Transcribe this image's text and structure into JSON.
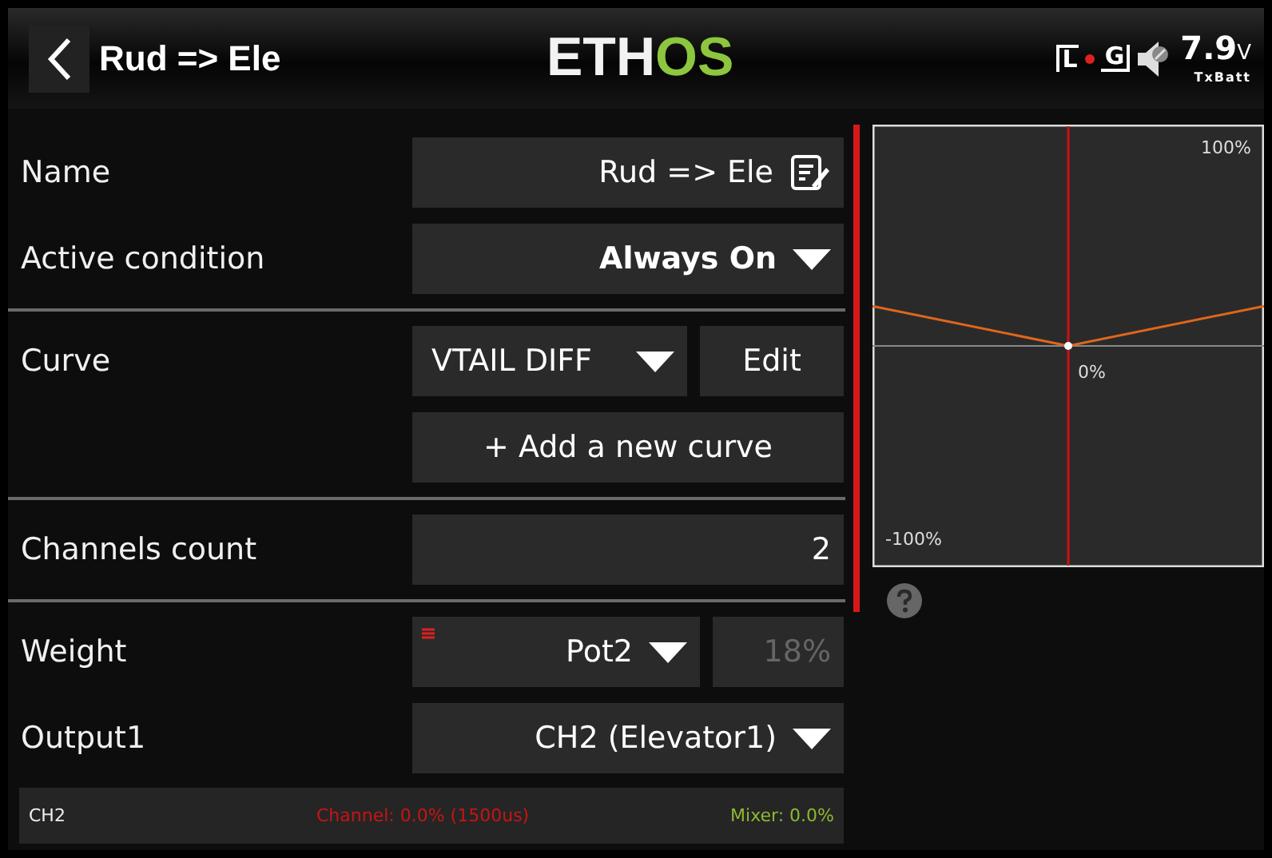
{
  "header": {
    "title": "Rud => Ele",
    "logo": {
      "part1": "ETH",
      "part2": "OS"
    },
    "status": {
      "left_marker": "L",
      "right_marker": "G",
      "voltage": "7.9",
      "unit": "V",
      "battery_label": "TxBatt"
    }
  },
  "rows": [
    {
      "kind": "text",
      "label": "Name",
      "value": "Rud => Ele",
      "bold": false,
      "divider_after": false
    },
    {
      "kind": "dropdown",
      "label": "Active condition",
      "value": "Always On",
      "bold": true,
      "divider_after": true
    },
    {
      "kind": "curve",
      "label": "Curve",
      "value": "VTAIL DIFF",
      "button": "Edit",
      "add_button": "+ Add a new curve",
      "divider_after": true
    },
    {
      "kind": "number",
      "label": "Channels count",
      "value": "2",
      "divider_after": true
    },
    {
      "kind": "weight",
      "label": "Weight",
      "source": "Pot2",
      "value": "18%",
      "value_disabled": true,
      "divider_after": false
    },
    {
      "kind": "dropdown",
      "label": "Output1",
      "value": "CH2 (Elevator1)",
      "bold": false,
      "divider_after": false
    }
  ],
  "status_bar": {
    "channel": "CH2",
    "channel_value": "Channel: 0.0% (1500us)",
    "mixer_value": "Mixer: 0.0%"
  },
  "curve_preview": {
    "top_label": "100%",
    "center_label": "0%",
    "bottom_label": "-100%"
  }
}
